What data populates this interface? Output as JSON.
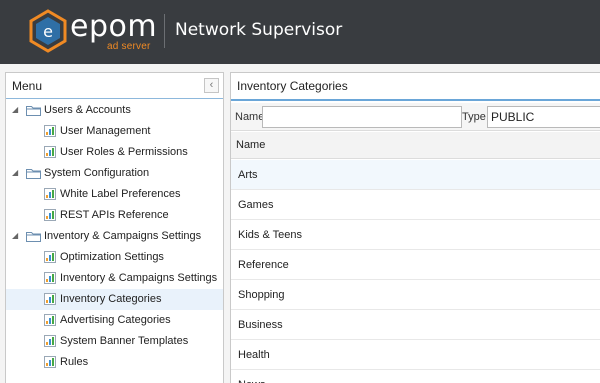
{
  "header": {
    "brand": "epom",
    "brand_sub": "ad server",
    "title": "Network Supervisor"
  },
  "menu": {
    "title": "Menu",
    "collapse_glyph": "‹",
    "groups": [
      {
        "label": "Users & Accounts",
        "items": [
          "User Management",
          "User Roles & Permissions"
        ]
      },
      {
        "label": "System Configuration",
        "items": [
          "White Label Preferences",
          "REST APIs Reference"
        ]
      },
      {
        "label": "Inventory & Campaigns Settings",
        "items": [
          "Optimization Settings",
          "Inventory & Campaigns Settings",
          "Inventory Categories",
          "Advertising Categories",
          "System Banner Templates",
          "Rules"
        ]
      }
    ],
    "selected_item": "Inventory Categories"
  },
  "content": {
    "title": "Inventory Categories",
    "filters": {
      "name_label": "Name",
      "name_value": "",
      "type_label": "Type",
      "type_value": "PUBLIC"
    },
    "column_header": "Name",
    "rows": [
      "Arts",
      "Games",
      "Kids & Teens",
      "Reference",
      "Shopping",
      "Business",
      "Health",
      "News"
    ]
  },
  "colors": {
    "topbar": "#393c40",
    "brand_accent": "#f08a24",
    "selection": "#e9f2fb",
    "header_underline": "#6aa6d8"
  }
}
